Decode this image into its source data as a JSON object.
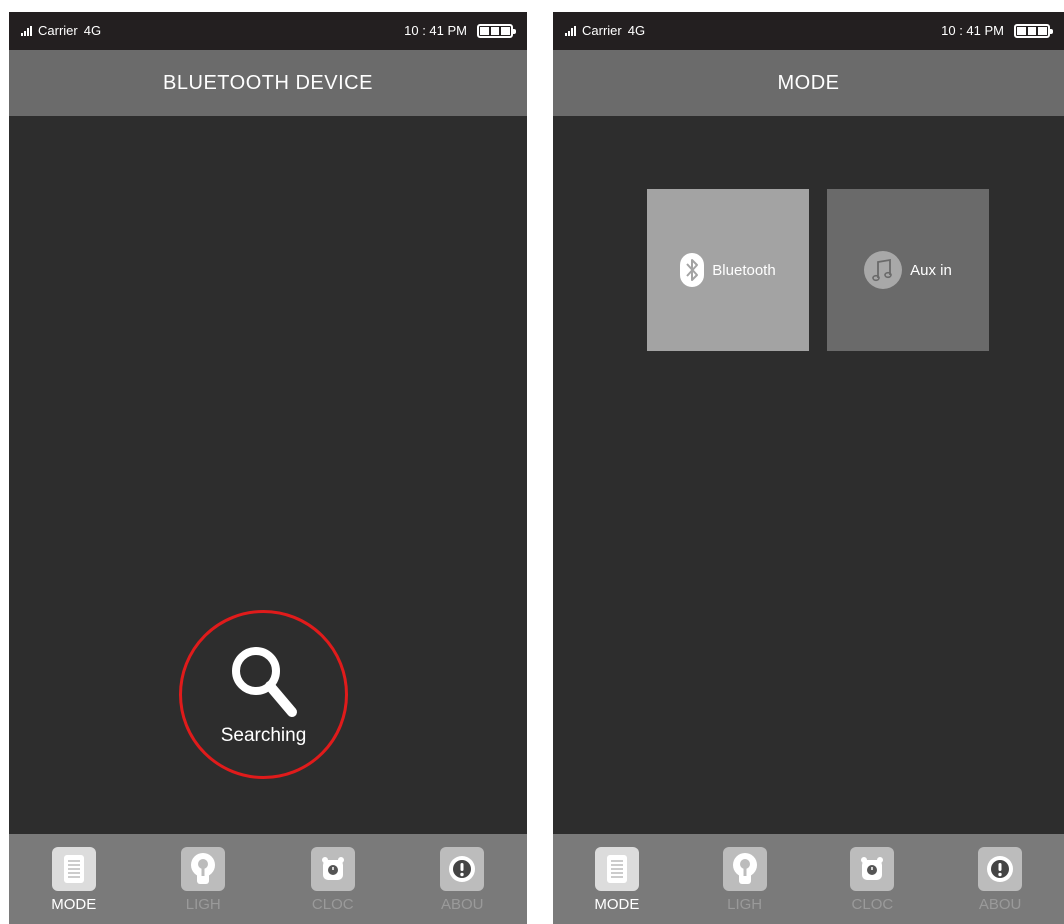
{
  "status": {
    "carrier": "Carrier",
    "network": "4G",
    "time": "10 : 41 PM"
  },
  "left_screen": {
    "title": "BLUETOOTH DEVICE",
    "search": {
      "label": "Searching",
      "icon": "search-icon",
      "ring_color": "#e01b1b"
    }
  },
  "right_screen": {
    "title": "MODE",
    "modes": [
      {
        "label": "Bluetooth",
        "icon": "bluetooth-icon"
      },
      {
        "label": "Aux in",
        "icon": "music-note-icon"
      }
    ]
  },
  "tabs": [
    {
      "label": "MODE",
      "icon": "list-icon",
      "active": true
    },
    {
      "label": "LIGH",
      "icon": "bulb-icon",
      "active": false
    },
    {
      "label": "CLOC",
      "icon": "alarm-clock-icon",
      "active": false
    },
    {
      "label": "ABOU",
      "icon": "info-icon",
      "active": false
    }
  ],
  "colors": {
    "status_bar": "#231f20",
    "title_bar": "#6b6b6b",
    "content": "#2d2d2d",
    "tab_bar": "#7a7a7a"
  }
}
